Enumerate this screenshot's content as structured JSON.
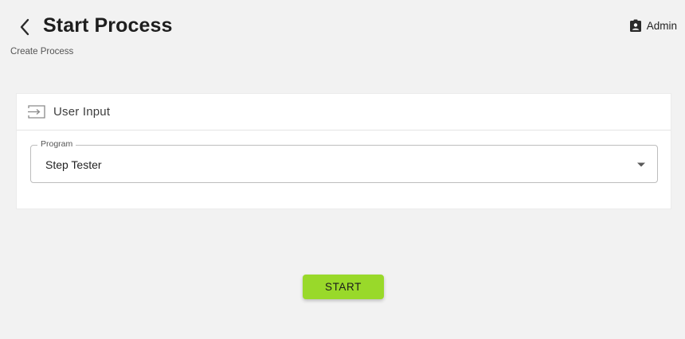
{
  "header": {
    "title": "Start Process",
    "subtitle": "Create Process",
    "back_icon": "chevron-left-icon"
  },
  "user_menu": {
    "name": "Admin",
    "icon": "badge-account-icon"
  },
  "card": {
    "title": "User Input",
    "icon": "input-icon",
    "program_field": {
      "label": "Program",
      "value": "Step Tester",
      "arrow_icon": "arrow-drop-down-icon"
    }
  },
  "actions": {
    "start_label": "START",
    "start_color": "#99d92a"
  }
}
